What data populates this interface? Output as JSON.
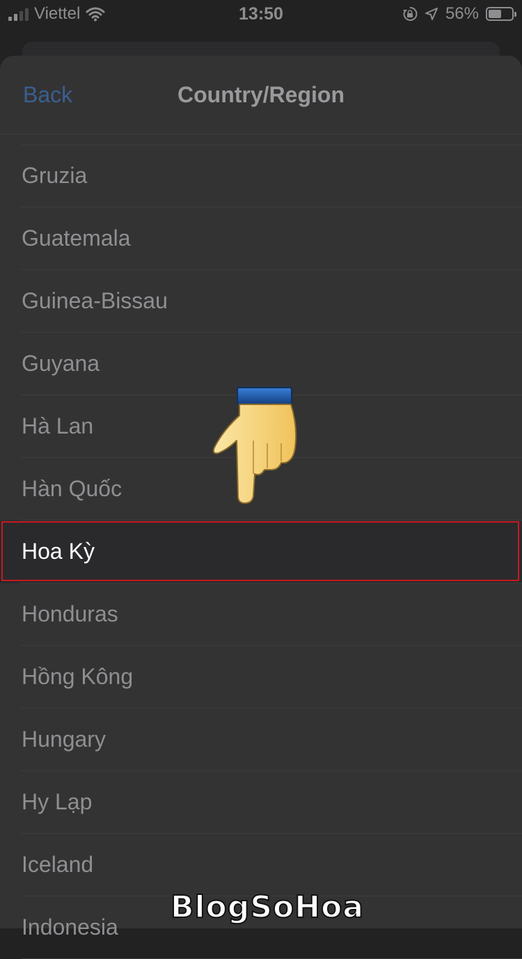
{
  "status_bar": {
    "carrier": "Viettel",
    "time": "13:50",
    "battery": "56%",
    "battery_level": 0.56
  },
  "nav": {
    "back_label": "Back",
    "title": "Country/Region"
  },
  "countries": [
    {
      "label": "Gruzia",
      "selected": false
    },
    {
      "label": "Guatemala",
      "selected": false
    },
    {
      "label": "Guinea-Bissau",
      "selected": false
    },
    {
      "label": "Guyana",
      "selected": false
    },
    {
      "label": "Hà Lan",
      "selected": false
    },
    {
      "label": "Hàn Quốc",
      "selected": false
    },
    {
      "label": "Hoa Kỳ",
      "selected": true
    },
    {
      "label": "Honduras",
      "selected": false
    },
    {
      "label": "Hồng Kông",
      "selected": false
    },
    {
      "label": "Hungary",
      "selected": false
    },
    {
      "label": "Hy Lạp",
      "selected": false
    },
    {
      "label": "Iceland",
      "selected": false
    },
    {
      "label": "Indonesia",
      "selected": false
    }
  ],
  "watermark": "BlogSoHoa",
  "colors": {
    "highlight_border": "#c9191f",
    "back_link": "#3a5f8f",
    "sheet_background": "#333334"
  },
  "icons": [
    "signal-icon",
    "wifi-icon",
    "rotation-lock-icon",
    "location-arrow-icon",
    "battery-icon",
    "pointing-hand-icon"
  ]
}
